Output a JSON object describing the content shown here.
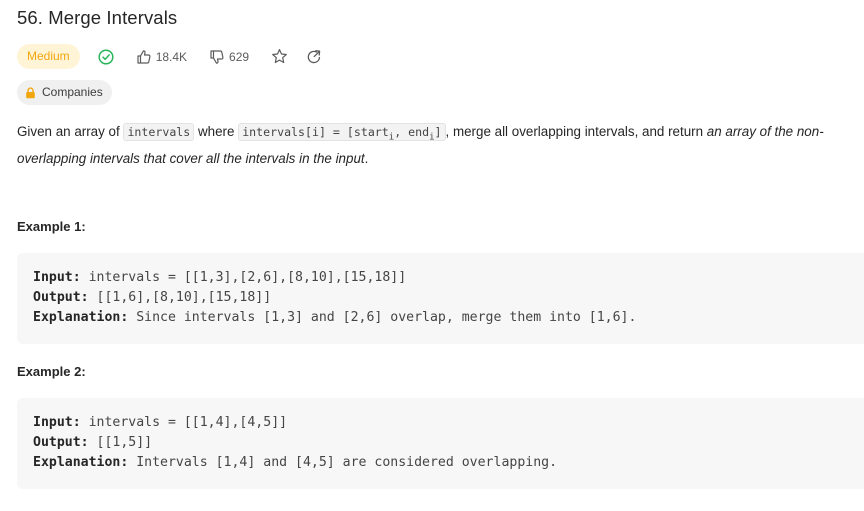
{
  "problem": {
    "title": "56. Merge Intervals",
    "difficulty": "Medium",
    "likes": "18.4K",
    "dislikes": "629",
    "companies_label": "Companies",
    "colors": {
      "difficulty_text": "#f2a60f",
      "difficulty_bg": "#fff4d6",
      "solved_check": "#2db55d"
    }
  },
  "description": {
    "part1": "Given an array of ",
    "code_intervals": "intervals",
    "part2": " where ",
    "code_assign": "intervals[i] = [start",
    "sub_i_1": "i",
    "code_comma_end": ", end",
    "sub_i_2": "i",
    "code_close": "]",
    "part3": ", merge all overlapping intervals, and return ",
    "emph": "an array of the non-overlapping intervals that cover all the intervals in the input",
    "part4": "."
  },
  "examples": [
    {
      "title": "Example 1:",
      "input_label": "Input:",
      "input_value": " intervals = [[1,3],[2,6],[8,10],[15,18]]",
      "output_label": "Output:",
      "output_value": " [[1,6],[8,10],[15,18]]",
      "explanation_label": "Explanation:",
      "explanation_value": " Since intervals [1,3] and [2,6] overlap, merge them into [1,6]."
    },
    {
      "title": "Example 2:",
      "input_label": "Input:",
      "input_value": " intervals = [[1,4],[4,5]]",
      "output_label": "Output:",
      "output_value": " [[1,5]]",
      "explanation_label": "Explanation:",
      "explanation_value": " Intervals [1,4] and [4,5] are considered overlapping."
    }
  ],
  "icons": [
    "check-circle-icon",
    "thumbs-up-icon",
    "thumbs-down-icon",
    "star-icon",
    "share-icon",
    "lock-icon"
  ]
}
